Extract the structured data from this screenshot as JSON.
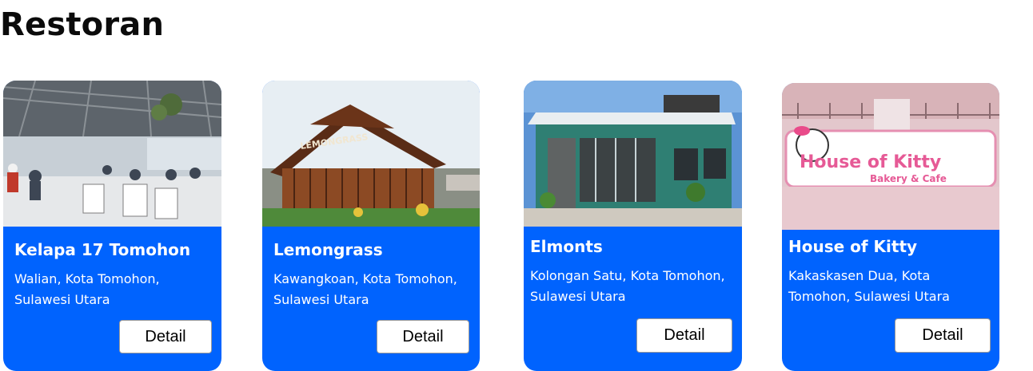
{
  "section": {
    "title": "Restoran"
  },
  "restaurants": [
    {
      "name": "Kelapa 17 Tomohon",
      "location": "Walian, Kota Tomohon, Sulawesi Utara",
      "button": "Detail"
    },
    {
      "name": "Lemongrass",
      "location": "Kawangkoan, Kota Tomohon, Sulawesi Utara",
      "button": "Detail"
    },
    {
      "name": "Elmonts",
      "location": "Kolongan Satu, Kota Tomohon, Sulawesi Utara",
      "button": "Detail"
    },
    {
      "name": "House of Kitty",
      "location": "Kakaskasen Dua, Kota Tomohon, Sulawesi Utara",
      "button": "Detail"
    }
  ],
  "colors": {
    "card": "#0063FE",
    "button": "#FFFFFF",
    "title": "#0B0B0B"
  },
  "photo_signs": {
    "lemongrass": "LEMONGRASS",
    "kitty_line1": "House of Kitty",
    "kitty_line2": "Bakery & Cafe"
  }
}
